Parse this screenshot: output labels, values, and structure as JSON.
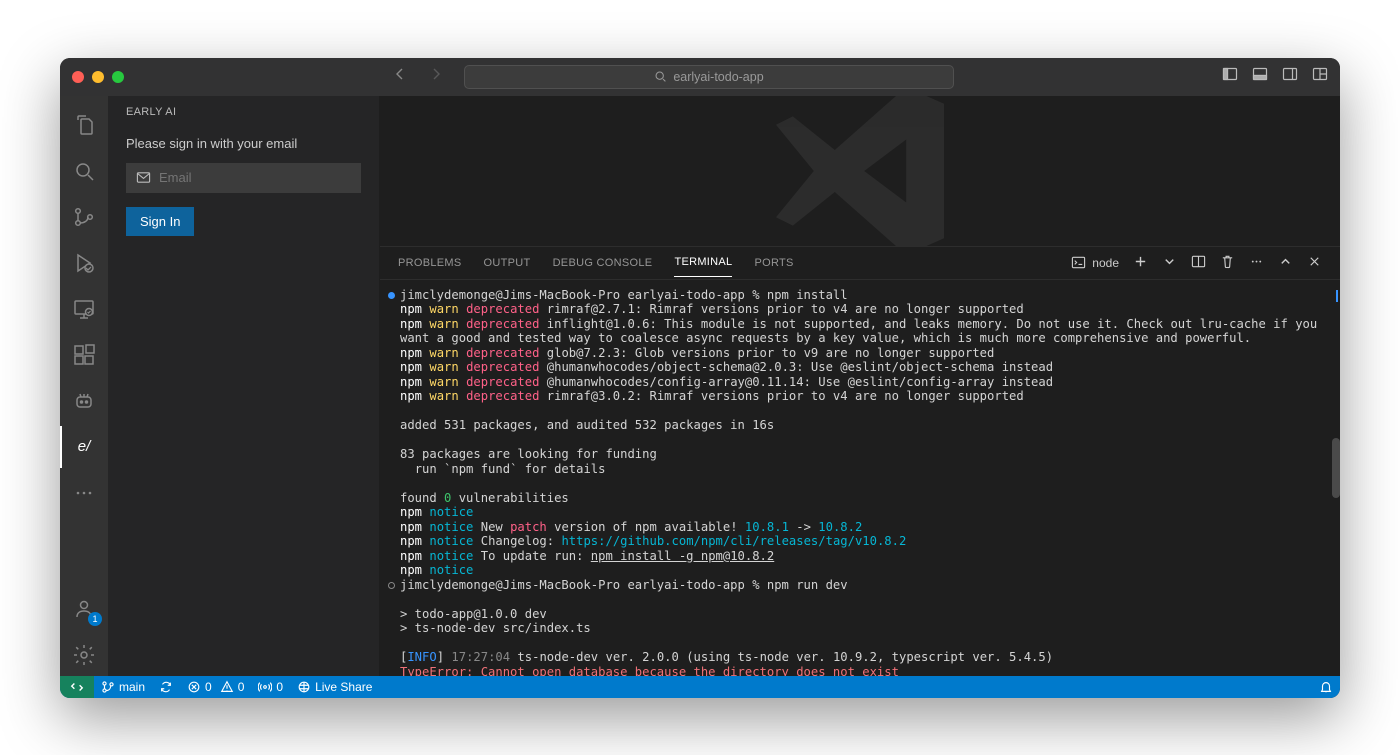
{
  "titlebar": {
    "search_text": "earlyai-todo-app"
  },
  "sidebar": {
    "title": "EARLY AI",
    "prompt": "Please sign in with your email",
    "email_placeholder": "Email",
    "signin_label": "Sign In",
    "active_label": "e/",
    "account_badge": "1"
  },
  "panel": {
    "tabs": {
      "problems": "PROBLEMS",
      "output": "OUTPUT",
      "debug": "DEBUG CONSOLE",
      "terminal": "TERMINAL",
      "ports": "PORTS"
    },
    "shell_label": "node"
  },
  "terminal": {
    "line1_prefix": "jimclydemonge@Jims-MacBook-Pro earlyai-todo-app % ",
    "line1_cmd": "npm install",
    "npm": "npm",
    "warn": "warn",
    "deprecated": "deprecated",
    "notice": "notice",
    "dep1": " rimraf@2.7.1: Rimraf versions prior to v4 are no longer supported",
    "dep2": " inflight@1.0.6: This module is not supported, and leaks memory. Do not use it. Check out lru-cache if you want a good and tested way to coalesce async requests by a key value, which is much more comprehensive and powerful.",
    "dep3": " glob@7.2.3: Glob versions prior to v9 are no longer supported",
    "dep4": " @humanwhocodes/object-schema@2.0.3: Use @eslint/object-schema instead",
    "dep5": " @humanwhocodes/config-array@0.11.14: Use @eslint/config-array instead",
    "dep6": " rimraf@3.0.2: Rimraf versions prior to v4 are no longer supported",
    "added": "added 531 packages, and audited 532 packages in 16s",
    "funding1": "83 packages are looking for funding",
    "funding2": "  run `npm fund` for details",
    "found_a": "found ",
    "found_b": "0",
    "found_c": " vulnerabilities",
    "notice2a": " New ",
    "notice2_patch": "patch",
    "notice2b": " version of npm available! ",
    "notice2_v1": "10.8.1",
    "notice2_arrow": " -> ",
    "notice2_v2": "10.8.2",
    "notice3a": " Changelog: ",
    "notice3_link": "https://github.com/npm/cli/releases/tag/v10.8.2",
    "notice4a": " To update run: ",
    "notice4_cmd": "npm install -g npm@10.8.2",
    "line2_prefix": "jimclydemonge@Jims-MacBook-Pro earlyai-todo-app % ",
    "line2_cmd": "npm run dev",
    "dev1": "> todo-app@1.0.0 dev",
    "dev2": "> ts-node-dev src/index.ts",
    "info_open": "[",
    "info_tag": "INFO",
    "info_close": "] ",
    "info_time": "17:27:04",
    "info_rest": " ts-node-dev ver. 2.0.0 (using ts-node ver. 10.9.2, typescript ver. 5.4.5)",
    "error": "TypeError: Cannot open database because the directory does not exist"
  },
  "statusbar": {
    "branch": "main",
    "errors": "0",
    "warnings": "0",
    "ports": "0",
    "liveshare": "Live Share"
  }
}
